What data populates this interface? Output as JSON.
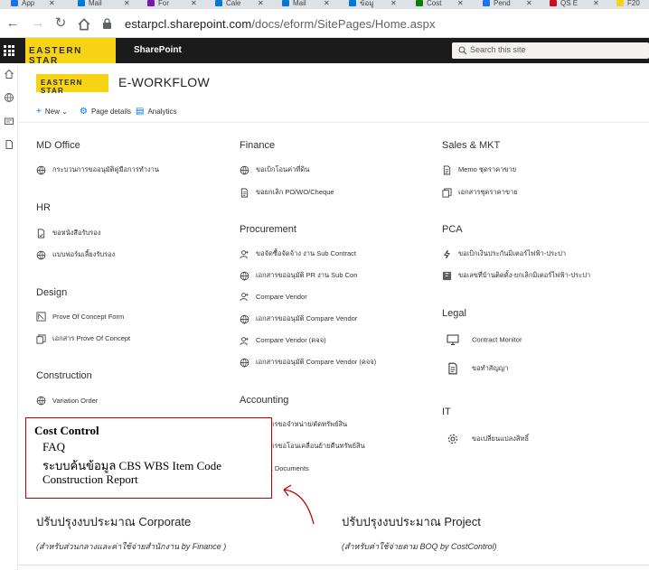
{
  "browser": {
    "tabs": [
      {
        "title": "App",
        "color": "#1a73e8"
      },
      {
        "title": "Mail",
        "color": "#0078d4"
      },
      {
        "title": "For",
        "color": "#7719aa"
      },
      {
        "title": "Cale",
        "color": "#0078d4"
      },
      {
        "title": "Mail",
        "color": "#0078d4"
      },
      {
        "title": "ข้อมู",
        "color": "#0078d4"
      },
      {
        "title": "Cost",
        "color": "#107c10"
      },
      {
        "title": "Pend",
        "color": "#1a73e8"
      },
      {
        "title": "QS E",
        "color": "#c50f1f"
      },
      {
        "title": "F20",
        "color": "#f6d314"
      }
    ],
    "url_host": "estarpcl.sharepoint.com",
    "url_path": "/docs/eform/SitePages/Home.aspx"
  },
  "suite": {
    "logo_text": "EASTERN STAR",
    "app_name": "SharePoint",
    "search_placeholder": "Search this site"
  },
  "site": {
    "logo_text": "EASTERN STAR",
    "title": "E-WORKFLOW"
  },
  "commands": {
    "new": "New",
    "page_details": "Page details",
    "analytics": "Analytics"
  },
  "sections": {
    "md_office": {
      "title": "MD Office",
      "items": [
        {
          "label": "กระบวนการขออนุมัติคู่มือการทำงาน",
          "icon": "globe-icon"
        }
      ]
    },
    "hr": {
      "title": "HR",
      "items": [
        {
          "label": "ขอหนังสือรับรอง",
          "icon": "document-form-icon"
        },
        {
          "label": "แบบฟอร์มเลี้ยงรับรอง",
          "icon": "globe-icon"
        }
      ]
    },
    "design": {
      "title": "Design",
      "items": [
        {
          "label": "Prove Of Concept Form",
          "icon": "form-icon"
        },
        {
          "label": "เอกสาร Prove Of Concept",
          "icon": "documents-icon"
        }
      ]
    },
    "construction": {
      "title": "Construction",
      "items": [
        {
          "label": "Variation Order",
          "icon": "globe-icon"
        }
      ]
    },
    "finance": {
      "title": "Finance",
      "items": [
        {
          "label": "ขอเบิกโอนค่าที่ดิน",
          "icon": "globe-icon"
        },
        {
          "label": "ขอยกเลิก PO/WO/Cheque",
          "icon": "document-list-icon"
        }
      ]
    },
    "procurement": {
      "title": "Procurement",
      "items": [
        {
          "label": "ขอจัดซื้อจัดจ้าง งาน Sub Contract",
          "icon": "person-add-icon"
        },
        {
          "label": "เอกสารขออนุมัติ PR งาน Sub Con",
          "icon": "globe-icon"
        },
        {
          "label": "Compare Vendor",
          "icon": "person-add-icon"
        },
        {
          "label": "เอกสารขออนุมัติ Compare Vendor",
          "icon": "globe-icon"
        },
        {
          "label": "Compare Vendor (คจจ)",
          "icon": "person-add-icon"
        },
        {
          "label": "เอกสารขออนุมัติ Compare Vendor (คจจ)",
          "icon": "globe-icon"
        }
      ]
    },
    "accounting": {
      "title": "Accounting",
      "items": [
        {
          "label": "เอกสารขอจำหน่าย/ตัดทรัพย์สิน",
          "icon": "document-list-icon"
        },
        {
          "label": "เอกสารขอโอนเคลื่อนย้ายคืนทรัพย์สิน",
          "icon": "document-list-icon"
        },
        {
          "label": "Asset Documents",
          "icon": "documents-icon"
        }
      ]
    },
    "sales_mkt": {
      "title": "Sales & MKT",
      "items": [
        {
          "label": "Memo ชุดราคาขาย",
          "icon": "document-list-icon"
        },
        {
          "label": "เอกสารชุดราคาขาย",
          "icon": "documents-icon"
        }
      ]
    },
    "pca": {
      "title": "PCA",
      "items": [
        {
          "label": "ขอเบิกเงินประกันมิเตอร์ไฟฟ้า-ประปา",
          "icon": "lightning-icon"
        },
        {
          "label": "ขอเลขที่บ้านติดตั้ง-ยกเลิกมิเตอร์ไฟฟ้า-ประปา",
          "icon": "forms-app-icon"
        }
      ]
    },
    "legal": {
      "title": "Legal",
      "items": [
        {
          "label": "Contract Monitor",
          "icon": "monitor-icon"
        },
        {
          "label": "ขอทำสัญญา",
          "icon": "document-list-icon"
        }
      ]
    },
    "it": {
      "title": "IT",
      "items": [
        {
          "label": "ขอเปลี่ยนแปลงสิทธิ์",
          "icon": "gear-icon"
        }
      ]
    }
  },
  "cost_control": {
    "title": "Cost Control",
    "lines": [
      "FAQ",
      "ระบบค้นข้อมูล CBS WBS Item Code",
      "Construction Report"
    ],
    "border_color": "#c00000"
  },
  "budget": {
    "corporate_title": "ปรับปรุงงบประมาณ Corporate",
    "corporate_sub": "(สำหรับส่วนกลางและค่าใช้จ่ายสำนักงาน by Finance )",
    "project_title": "ปรับปรุงงบประมาณ Project",
    "project_sub": "(สำหรับค่าใช้จ่ายตาม BOQ by CostControl)"
  },
  "colors": {
    "brand_yellow": "#f6d314",
    "suite_bg": "#1b1b1b",
    "accent": "#0078d4",
    "annotation_red": "#c00000"
  }
}
